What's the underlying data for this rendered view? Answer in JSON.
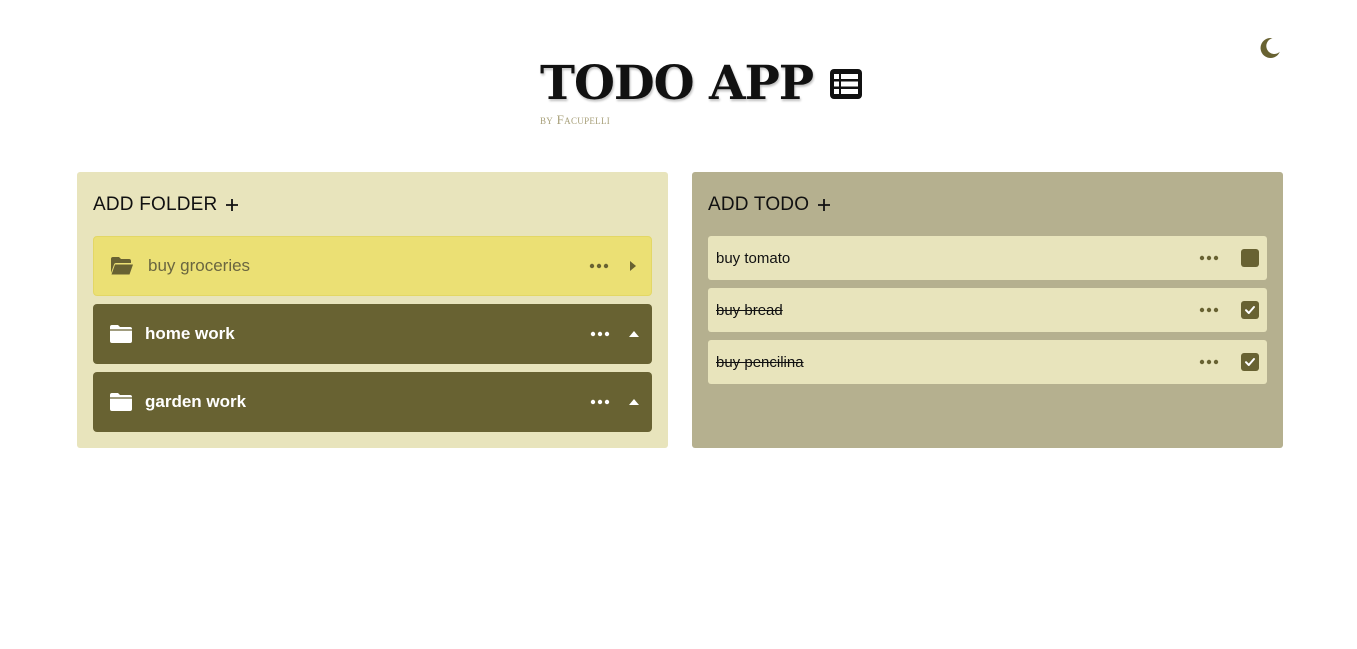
{
  "header": {
    "title": "TODO APP",
    "byline": "by Facupelli",
    "title_icon": "list-icon",
    "theme_icon": "moon-icon"
  },
  "folders_panel": {
    "title": "ADD FOLDER",
    "folders": [
      {
        "name": "buy groceries",
        "state": "open",
        "caret": "caret-right"
      },
      {
        "name": "home work",
        "state": "closed",
        "caret": "caret-up"
      },
      {
        "name": "garden work",
        "state": "closed",
        "caret": "caret-up"
      }
    ]
  },
  "todos_panel": {
    "title": "ADD TODO",
    "todos": [
      {
        "text": "buy tomato",
        "done": false
      },
      {
        "text": "buy bread",
        "done": true
      },
      {
        "text": "buy pencilina",
        "done": true
      }
    ]
  },
  "colors": {
    "olive": "#686232",
    "folder_active": "#ebe074",
    "panel_light": "#e8e4bc",
    "panel_dark": "#b5b08f",
    "byline": "#a8a07a"
  }
}
